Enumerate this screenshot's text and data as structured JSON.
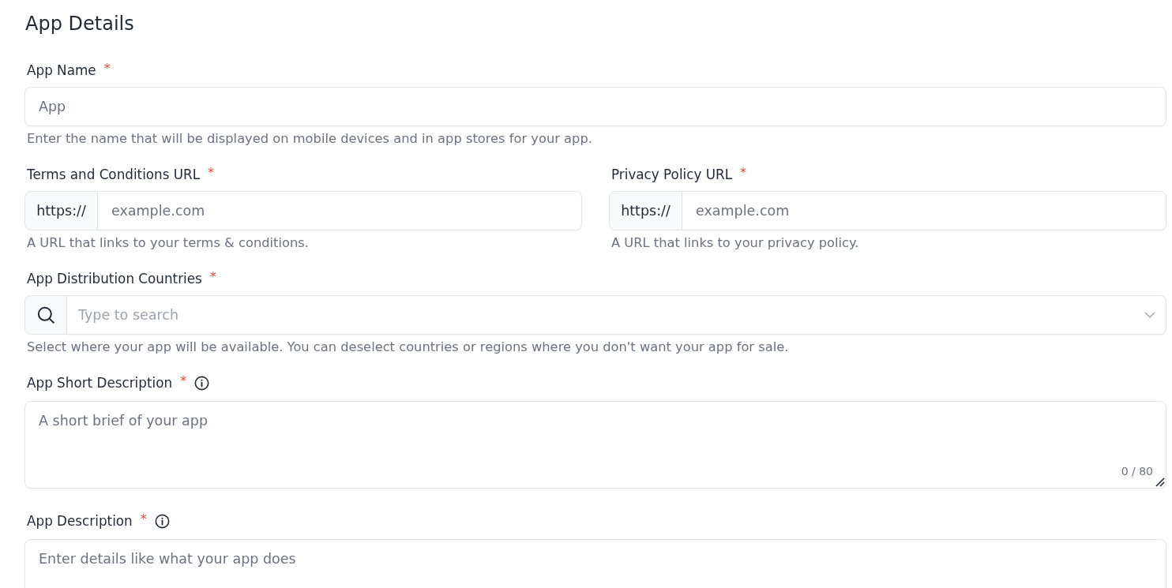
{
  "page": {
    "title": "App Details"
  },
  "rows": [
    {
      "fields": [
        {
          "kind": "text",
          "label": "App Name",
          "required_mark": "*",
          "info": false,
          "placeholder": "App",
          "help": "Enter the name that will be displayed on mobile devices and in app stores for your app."
        }
      ]
    },
    {
      "fields": [
        {
          "kind": "url",
          "label": "Terms and Conditions URL",
          "required_mark": "*",
          "info": false,
          "prefix": "https://",
          "placeholder": "example.com",
          "help": "A URL that links to your terms & conditions."
        },
        {
          "kind": "url",
          "label": "Privacy Policy URL",
          "required_mark": "*",
          "info": false,
          "prefix": "https://",
          "placeholder": "example.com",
          "help": "A URL that links to your privacy policy."
        }
      ]
    },
    {
      "fields": [
        {
          "kind": "search_select",
          "label": "App Distribution Countries",
          "required_mark": "*",
          "info": false,
          "placeholder": "Type to search",
          "help": "Select where your app will be available. You can deselect countries or regions where you don't want your app for sale."
        }
      ]
    },
    {
      "fields": [
        {
          "kind": "textarea",
          "label": "App Short Description",
          "required_mark": "*",
          "info": true,
          "placeholder": "A short brief of your app",
          "counter": "0 / 80",
          "resizable": true
        }
      ]
    },
    {
      "fields": [
        {
          "kind": "textarea",
          "label": "App Description",
          "required_mark": "*",
          "info": true,
          "placeholder": "Enter details like what your app does",
          "resizable": false
        }
      ]
    }
  ]
}
